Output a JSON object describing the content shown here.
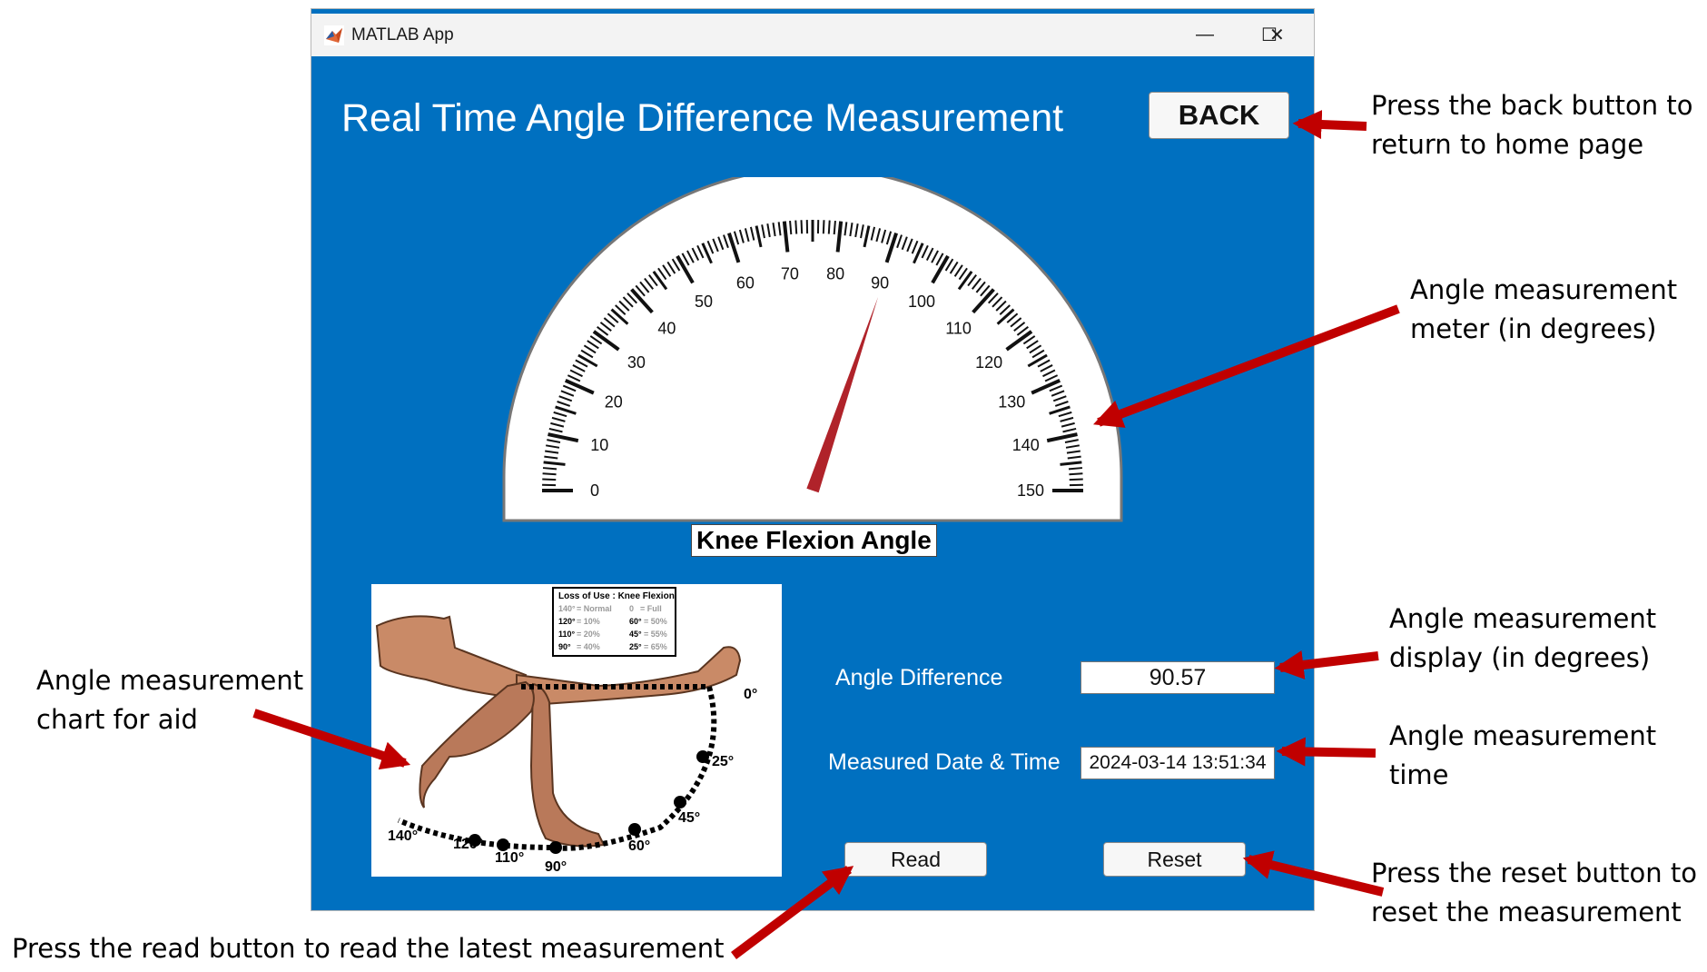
{
  "window": {
    "title": "MATLAB App",
    "controls": {
      "minimize": "—",
      "maximize": "☐",
      "close": "✕"
    }
  },
  "app": {
    "title": "Real Time Angle Difference Measurement",
    "back_label": "BACK"
  },
  "gauge": {
    "label": "Knee Flexion Angle",
    "min": 0,
    "max": 150,
    "tick_labels": [
      "0",
      "10",
      "20",
      "30",
      "40",
      "50",
      "60",
      "70",
      "80",
      "90",
      "100",
      "110",
      "120",
      "130",
      "140",
      "150"
    ],
    "needle_value": 90.57,
    "needle_color": "#b0232a"
  },
  "aid_chart": {
    "table_title": "Loss of Use : Knee Flexion",
    "rows": [
      {
        "deg": "140°",
        "val": "= Normal",
        "deg2": "0",
        "val2": "= Full"
      },
      {
        "deg": "120°",
        "val": "= 10%",
        "deg2": "60°",
        "val2": "= 50%"
      },
      {
        "deg": "110°",
        "val": "= 20%",
        "deg2": "45°",
        "val2": "= 55%"
      },
      {
        "deg": "90°",
        "val": "= 40%",
        "deg2": "25°",
        "val2": "= 65%"
      }
    ],
    "arc_labels": {
      "a0": "0°",
      "a25": "25°",
      "a45": "45°",
      "a60": "60°",
      "a90": "90°",
      "a110": "110°",
      "a120": "120°",
      "a140": "140°"
    }
  },
  "fields": {
    "angle_difference_label": "Angle Difference",
    "angle_difference_value": "90.57",
    "datetime_label": "Measured Date & Time",
    "datetime_value": "2024-03-14 13:51:34"
  },
  "buttons": {
    "read": "Read",
    "reset": "Reset"
  },
  "annotations": {
    "back_line1": "Press the back button to",
    "back_line2": "return to home page",
    "meter_line1": "Angle measurement",
    "meter_line2": "meter (in degrees)",
    "display_line1": "Angle measurement",
    "display_line2": "display (in degrees)",
    "time_line1": "Angle measurement",
    "time_line2": "time",
    "reset_line1": "Press the reset button to",
    "reset_line2": "reset the measurement",
    "chart_line1": "Angle measurement",
    "chart_line2": "chart for aid",
    "read_line": "Press the read button to read the latest measurement"
  },
  "colors": {
    "app_background": "#0070c0",
    "arrow": "#c00000"
  }
}
